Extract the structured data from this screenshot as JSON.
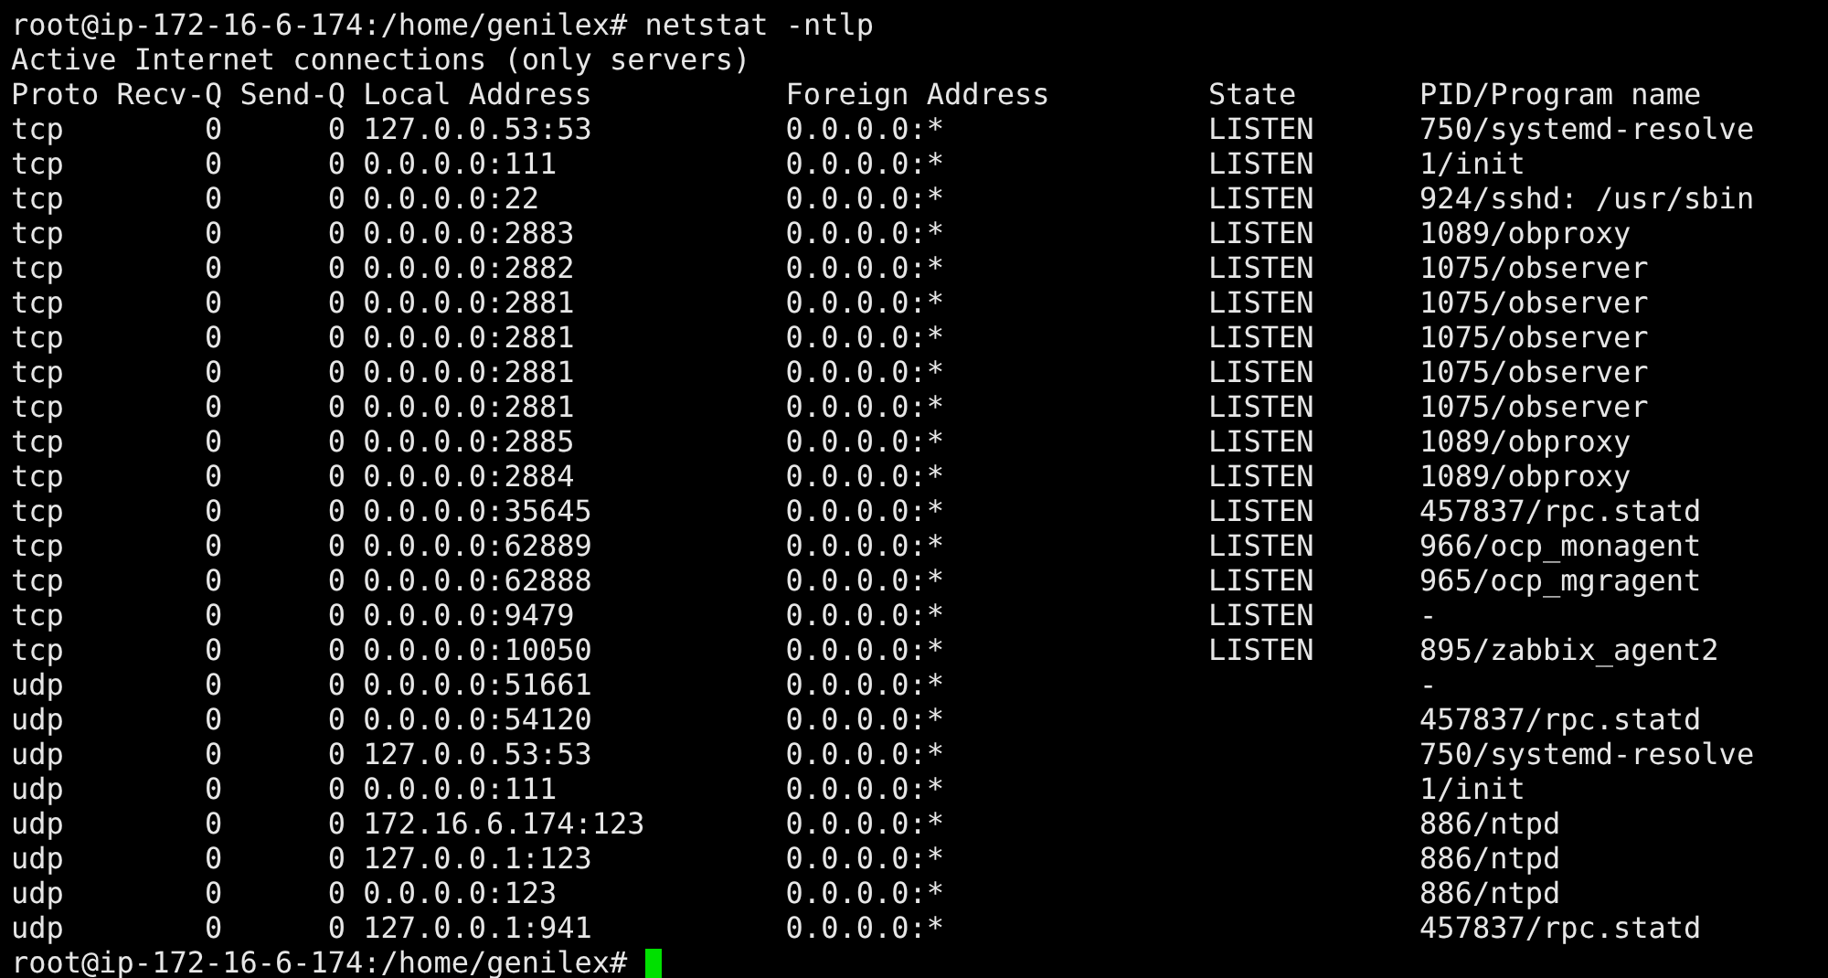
{
  "terminal": {
    "command_line": "root@ip-172-16-6-174:/home/genilex# netstat -ntlp",
    "title": "Active Internet connections (only servers)",
    "columns": [
      "Proto",
      "Recv-Q",
      "Send-Q",
      "Local Address",
      "Foreign Address",
      "State",
      "PID/Program name"
    ],
    "rows": [
      {
        "proto": "tcp",
        "recv_q": "0",
        "send_q": "0",
        "local": "127.0.0.53:53",
        "foreign": "0.0.0.0:*",
        "state": "LISTEN",
        "program": "750/systemd-resolve"
      },
      {
        "proto": "tcp",
        "recv_q": "0",
        "send_q": "0",
        "local": "0.0.0.0:111",
        "foreign": "0.0.0.0:*",
        "state": "LISTEN",
        "program": "1/init"
      },
      {
        "proto": "tcp",
        "recv_q": "0",
        "send_q": "0",
        "local": "0.0.0.0:22",
        "foreign": "0.0.0.0:*",
        "state": "LISTEN",
        "program": "924/sshd: /usr/sbin"
      },
      {
        "proto": "tcp",
        "recv_q": "0",
        "send_q": "0",
        "local": "0.0.0.0:2883",
        "foreign": "0.0.0.0:*",
        "state": "LISTEN",
        "program": "1089/obproxy"
      },
      {
        "proto": "tcp",
        "recv_q": "0",
        "send_q": "0",
        "local": "0.0.0.0:2882",
        "foreign": "0.0.0.0:*",
        "state": "LISTEN",
        "program": "1075/observer"
      },
      {
        "proto": "tcp",
        "recv_q": "0",
        "send_q": "0",
        "local": "0.0.0.0:2881",
        "foreign": "0.0.0.0:*",
        "state": "LISTEN",
        "program": "1075/observer"
      },
      {
        "proto": "tcp",
        "recv_q": "0",
        "send_q": "0",
        "local": "0.0.0.0:2881",
        "foreign": "0.0.0.0:*",
        "state": "LISTEN",
        "program": "1075/observer"
      },
      {
        "proto": "tcp",
        "recv_q": "0",
        "send_q": "0",
        "local": "0.0.0.0:2881",
        "foreign": "0.0.0.0:*",
        "state": "LISTEN",
        "program": "1075/observer"
      },
      {
        "proto": "tcp",
        "recv_q": "0",
        "send_q": "0",
        "local": "0.0.0.0:2881",
        "foreign": "0.0.0.0:*",
        "state": "LISTEN",
        "program": "1075/observer"
      },
      {
        "proto": "tcp",
        "recv_q": "0",
        "send_q": "0",
        "local": "0.0.0.0:2885",
        "foreign": "0.0.0.0:*",
        "state": "LISTEN",
        "program": "1089/obproxy"
      },
      {
        "proto": "tcp",
        "recv_q": "0",
        "send_q": "0",
        "local": "0.0.0.0:2884",
        "foreign": "0.0.0.0:*",
        "state": "LISTEN",
        "program": "1089/obproxy"
      },
      {
        "proto": "tcp",
        "recv_q": "0",
        "send_q": "0",
        "local": "0.0.0.0:35645",
        "foreign": "0.0.0.0:*",
        "state": "LISTEN",
        "program": "457837/rpc.statd"
      },
      {
        "proto": "tcp",
        "recv_q": "0",
        "send_q": "0",
        "local": "0.0.0.0:62889",
        "foreign": "0.0.0.0:*",
        "state": "LISTEN",
        "program": "966/ocp_monagent"
      },
      {
        "proto": "tcp",
        "recv_q": "0",
        "send_q": "0",
        "local": "0.0.0.0:62888",
        "foreign": "0.0.0.0:*",
        "state": "LISTEN",
        "program": "965/ocp_mgragent"
      },
      {
        "proto": "tcp",
        "recv_q": "0",
        "send_q": "0",
        "local": "0.0.0.0:9479",
        "foreign": "0.0.0.0:*",
        "state": "LISTEN",
        "program": "-"
      },
      {
        "proto": "tcp",
        "recv_q": "0",
        "send_q": "0",
        "local": "0.0.0.0:10050",
        "foreign": "0.0.0.0:*",
        "state": "LISTEN",
        "program": "895/zabbix_agent2"
      },
      {
        "proto": "udp",
        "recv_q": "0",
        "send_q": "0",
        "local": "0.0.0.0:51661",
        "foreign": "0.0.0.0:*",
        "program": "-"
      },
      {
        "proto": "udp",
        "recv_q": "0",
        "send_q": "0",
        "local": "0.0.0.0:54120",
        "foreign": "0.0.0.0:*",
        "program": "457837/rpc.statd"
      },
      {
        "proto": "udp",
        "recv_q": "0",
        "send_q": "0",
        "local": "127.0.0.53:53",
        "foreign": "0.0.0.0:*",
        "program": "750/systemd-resolve"
      },
      {
        "proto": "udp",
        "recv_q": "0",
        "send_q": "0",
        "local": "0.0.0.0:111",
        "foreign": "0.0.0.0:*",
        "program": "1/init"
      },
      {
        "proto": "udp",
        "recv_q": "0",
        "send_q": "0",
        "local": "172.16.6.174:123",
        "foreign": "0.0.0.0:*",
        "program": "886/ntpd"
      },
      {
        "proto": "udp",
        "recv_q": "0",
        "send_q": "0",
        "local": "127.0.0.1:123",
        "foreign": "0.0.0.0:*",
        "program": "886/ntpd"
      },
      {
        "proto": "udp",
        "recv_q": "0",
        "send_q": "0",
        "local": "0.0.0.0:123",
        "foreign": "0.0.0.0:*",
        "program": "886/ntpd"
      },
      {
        "proto": "udp",
        "recv_q": "0",
        "send_q": "0",
        "local": "127.0.0.1:941",
        "foreign": "0.0.0.0:*",
        "program": "457837/rpc.statd"
      }
    ],
    "prompt": "root@ip-172-16-6-174:/home/genilex#"
  }
}
